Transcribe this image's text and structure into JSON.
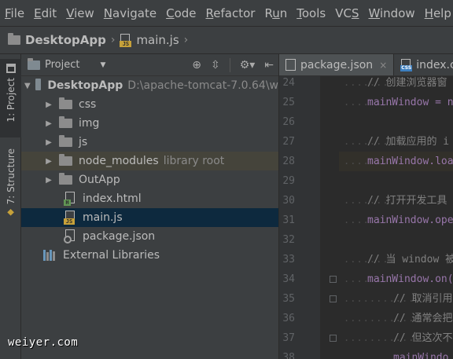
{
  "menu": {
    "items": [
      {
        "pre": "",
        "ul": "F",
        "post": "ile"
      },
      {
        "pre": "",
        "ul": "E",
        "post": "dit"
      },
      {
        "pre": "",
        "ul": "V",
        "post": "iew"
      },
      {
        "pre": "",
        "ul": "N",
        "post": "avigate"
      },
      {
        "pre": "",
        "ul": "C",
        "post": "ode"
      },
      {
        "pre": "",
        "ul": "R",
        "post": "efactor"
      },
      {
        "pre": "R",
        "ul": "u",
        "post": "n"
      },
      {
        "pre": "",
        "ul": "T",
        "post": "ools"
      },
      {
        "pre": "VC",
        "ul": "S",
        "post": ""
      },
      {
        "pre": "",
        "ul": "W",
        "post": "indow"
      },
      {
        "pre": "",
        "ul": "H",
        "post": "elp"
      }
    ]
  },
  "breadcrumb": {
    "project": "DesktopApp",
    "file": "main.js"
  },
  "stripe": {
    "project_tab": "1: Project",
    "structure_tab": "7: Structure"
  },
  "project_panel": {
    "title": "Project",
    "root": {
      "name": "DesktopApp",
      "path": "D:\\apache-tomcat-7.0.64\\w"
    },
    "folders": [
      {
        "name": "css",
        "hint": ""
      },
      {
        "name": "img",
        "hint": ""
      },
      {
        "name": "js",
        "hint": ""
      },
      {
        "name": "node_modules",
        "hint": "library root"
      },
      {
        "name": "OutApp",
        "hint": ""
      }
    ],
    "files": [
      {
        "name": "index.html",
        "badge": "H"
      },
      {
        "name": "main.js",
        "badge": "JS"
      },
      {
        "name": "package.json",
        "badge": ""
      }
    ],
    "external": "External Libraries"
  },
  "editor": {
    "tabs": [
      {
        "label": "package.json",
        "close": "×"
      },
      {
        "label": "index.c",
        "badge": "CSS"
      }
    ],
    "lines": [
      {
        "n": "24",
        "text": "// 创建浏览器窗",
        "kind": "comment"
      },
      {
        "n": "25",
        "text": "mainWindow = n",
        "kind": "assign"
      },
      {
        "n": "26",
        "text": "",
        "kind": "blank"
      },
      {
        "n": "27",
        "text": "// 加载应用的 i",
        "kind": "comment"
      },
      {
        "n": "28",
        "text": "mainWindow.loa",
        "kind": "call"
      },
      {
        "n": "29",
        "text": "",
        "kind": "blank"
      },
      {
        "n": "30",
        "text": "// 打开开发工具",
        "kind": "comment"
      },
      {
        "n": "31",
        "text": "mainWindow.ope",
        "kind": "call"
      },
      {
        "n": "32",
        "text": "",
        "kind": "blank"
      },
      {
        "n": "33",
        "text": "// 当 window 被",
        "kind": "comment"
      },
      {
        "n": "34",
        "text": "mainWindow.on(",
        "kind": "call"
      },
      {
        "n": "35",
        "text": "// 取消引用",
        "kind": "comment2"
      },
      {
        "n": "36",
        "text": "// 通常会把",
        "kind": "comment2"
      },
      {
        "n": "37",
        "text": "// 但这次不",
        "kind": "comment2"
      },
      {
        "n": "38",
        "text": "mainWindo",
        "kind": "partial"
      }
    ]
  },
  "watermark": "weiyer.com",
  "colors": {
    "background": "#2b2b2b",
    "panel": "#3c3f41",
    "selection": "#0d293e",
    "comment": "#808080",
    "object": "#9876aa",
    "keyword": "#cc7832"
  }
}
